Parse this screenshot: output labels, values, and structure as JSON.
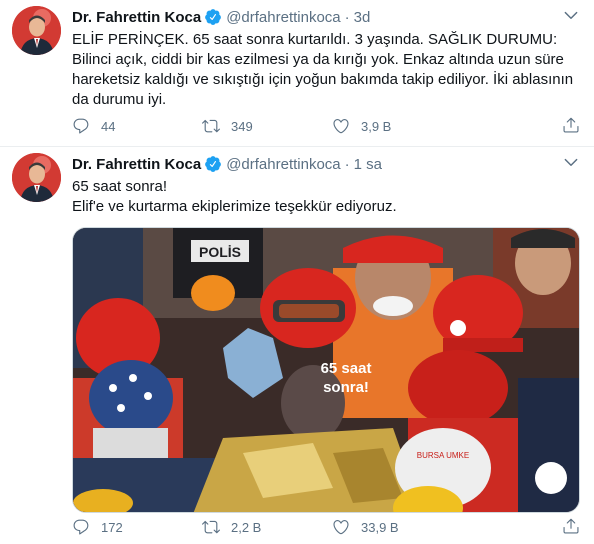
{
  "tweets": [
    {
      "name": "Dr. Fahrettin Koca",
      "handle": "@drfahrettinkoca",
      "dot": "·",
      "time": "3d",
      "text": "ELİF PERİNÇEK. 65 saat sonra kurtarıldı. 3 yaşında. SAĞLIK DURUMU: Bilinci açık, ciddi bir kas ezilmesi ya da kırığı yok. Enkaz altında uzun süre hareketsiz kaldığı ve sıkıştığı için yoğun bakımda takip ediliyor. İki ablasının da durumu iyi.",
      "replies": "44",
      "retweets": "349",
      "likes": "3,9 B"
    },
    {
      "name": "Dr. Fahrettin Koca",
      "handle": "@drfahrettinkoca",
      "dot": "·",
      "time": "1 sa",
      "text": "65 saat sonra!\nElif'e ve kurtarma ekiplerimize teşekkür ediyoruz.",
      "media": {
        "overlay_text_1": "65 saat",
        "overlay_text_2": "sonra!",
        "vest_text": "POLİS",
        "helmet_text": "BURSA UMKE"
      },
      "replies": "172",
      "retweets": "2,2 B",
      "likes": "33,9 B"
    }
  ],
  "colors": {
    "text": "#0f1419",
    "secondary": "#5b7083",
    "verified": "#1da1f2",
    "divider": "#ebeef0"
  },
  "icons": [
    "verified-badge-icon",
    "chevron-down-icon",
    "reply-icon",
    "retweet-icon",
    "like-icon",
    "share-icon"
  ]
}
